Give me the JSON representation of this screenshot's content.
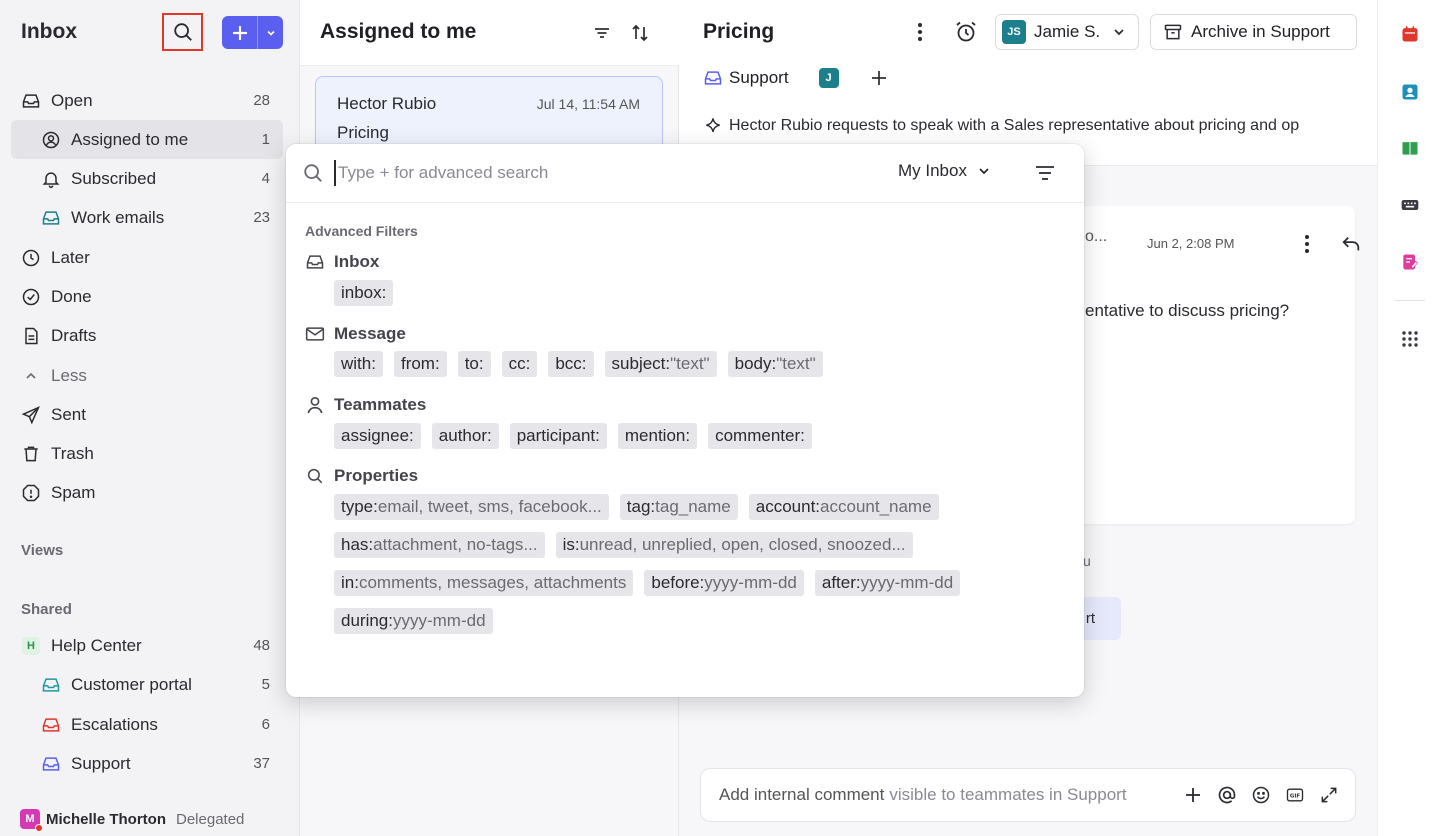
{
  "sidebar": {
    "title": "Inbox",
    "items": [
      {
        "label": "Open",
        "count": "28"
      },
      {
        "label": "Assigned to me",
        "count": "1"
      },
      {
        "label": "Subscribed",
        "count": "4"
      },
      {
        "label": "Work emails",
        "count": "23"
      },
      {
        "label": "Later",
        "count": ""
      },
      {
        "label": "Done",
        "count": ""
      },
      {
        "label": "Drafts",
        "count": ""
      },
      {
        "label": "Less",
        "count": ""
      },
      {
        "label": "Sent",
        "count": ""
      },
      {
        "label": "Trash",
        "count": ""
      },
      {
        "label": "Spam",
        "count": ""
      }
    ],
    "views_label": "Views",
    "shared_label": "Shared",
    "shared": [
      {
        "label": "Help Center",
        "count": "48",
        "badge": "H"
      },
      {
        "label": "Customer portal",
        "count": "5"
      },
      {
        "label": "Escalations",
        "count": "6"
      },
      {
        "label": "Support",
        "count": "37"
      }
    ],
    "user": {
      "initial": "M",
      "name": "Michelle Thorton",
      "status": "Delegated"
    }
  },
  "list": {
    "title": "Assigned to me",
    "card": {
      "name": "Hector Rubio",
      "time": "Jul 14, 11:54 AM",
      "subject": "Pricing"
    }
  },
  "pane": {
    "title": "Pricing",
    "assignee": {
      "initials": "JS",
      "name": "Jamie S."
    },
    "archive_label": "Archive in Support",
    "inbox_tag": "Support",
    "teammate_badge": "J",
    "summary": "Hector Rubio requests to speak with a Sales representative about pricing and op",
    "message": {
      "from_fragment": "o...",
      "time": "Jun 2, 2:08 PM",
      "body_fragment": "entative to discuss pricing?"
    },
    "behind_text": "u",
    "behind_button": "rt",
    "composer": {
      "placeholder_main": "Add internal comment",
      "placeholder_hint": "visible to teammates in Support"
    }
  },
  "search": {
    "placeholder": "Type + for advanced search",
    "scope": "My Inbox",
    "advanced_label": "Advanced Filters",
    "groups": [
      {
        "title": "Inbox",
        "icon": "inbox-icon",
        "rows": [
          [
            {
              "k": "inbox:",
              "h": ""
            }
          ]
        ]
      },
      {
        "title": "Message",
        "icon": "envelope-icon",
        "rows": [
          [
            {
              "k": "with:",
              "h": ""
            },
            {
              "k": "from:",
              "h": ""
            },
            {
              "k": "to:",
              "h": ""
            },
            {
              "k": "cc:",
              "h": ""
            },
            {
              "k": "bcc:",
              "h": ""
            },
            {
              "k": "subject:",
              "h": "\"text\""
            },
            {
              "k": "body:",
              "h": "\"text\""
            }
          ]
        ]
      },
      {
        "title": "Teammates",
        "icon": "person-icon",
        "rows": [
          [
            {
              "k": "assignee:",
              "h": ""
            },
            {
              "k": "author:",
              "h": ""
            },
            {
              "k": "participant:",
              "h": ""
            },
            {
              "k": "mention:",
              "h": ""
            },
            {
              "k": "commenter:",
              "h": ""
            }
          ]
        ]
      },
      {
        "title": "Properties",
        "icon": "search-icon",
        "rows": [
          [
            {
              "k": "type:",
              "h": "email, tweet, sms, facebook..."
            },
            {
              "k": "tag:",
              "h": "tag_name"
            },
            {
              "k": "account:",
              "h": "account_name"
            }
          ],
          [
            {
              "k": "has:",
              "h": "attachment, no-tags..."
            },
            {
              "k": "is:",
              "h": "unread, unreplied, open, closed, snoozed..."
            }
          ],
          [
            {
              "k": "in:",
              "h": "comments, messages, attachments"
            },
            {
              "k": "before:",
              "h": "yyyy-mm-dd"
            },
            {
              "k": "after:",
              "h": "yyyy-mm-dd"
            }
          ],
          [
            {
              "k": "during:",
              "h": "yyyy-mm-dd"
            }
          ]
        ]
      }
    ]
  },
  "colors": {
    "accent": "#5b5ff0",
    "highlight": "#e0372c",
    "teal": "#1d7f8c"
  }
}
